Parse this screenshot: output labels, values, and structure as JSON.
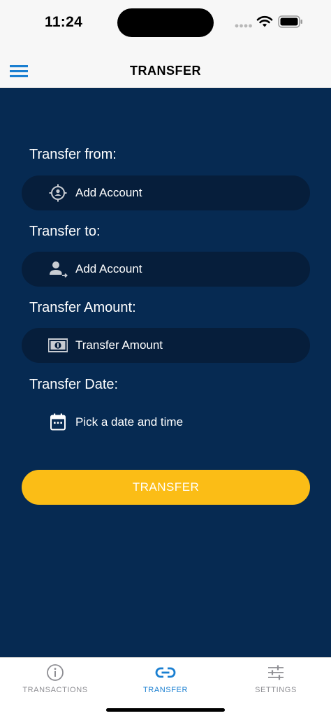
{
  "status_bar": {
    "time": "11:24"
  },
  "nav": {
    "title": "TRANSFER",
    "menu_icon": "hamburger-menu-icon"
  },
  "form": {
    "from_label": "Transfer from:",
    "from_value": "Add Account",
    "from_icon": "account-target-icon",
    "to_label": "Transfer to:",
    "to_value": "Add Account",
    "to_icon": "person-transfer-icon",
    "amount_label": "Transfer Amount:",
    "amount_placeholder": "Transfer Amount",
    "amount_icon": "money-icon",
    "date_label": "Transfer Date:",
    "date_value": "Pick a date and time",
    "date_icon": "calendar-icon",
    "submit_label": "TRANSFER"
  },
  "tabs": [
    {
      "label": "TRANSACTIONS",
      "icon": "info-icon",
      "active": false
    },
    {
      "label": "TRANSFER",
      "icon": "link-icon",
      "active": true
    },
    {
      "label": "SETTINGS",
      "icon": "sliders-icon",
      "active": false
    }
  ],
  "colors": {
    "background": "#062a52",
    "field": "#061e3b",
    "accent": "#fbbd16",
    "active_tab": "#1a7fd1",
    "inactive_tab": "#8e8e93"
  }
}
